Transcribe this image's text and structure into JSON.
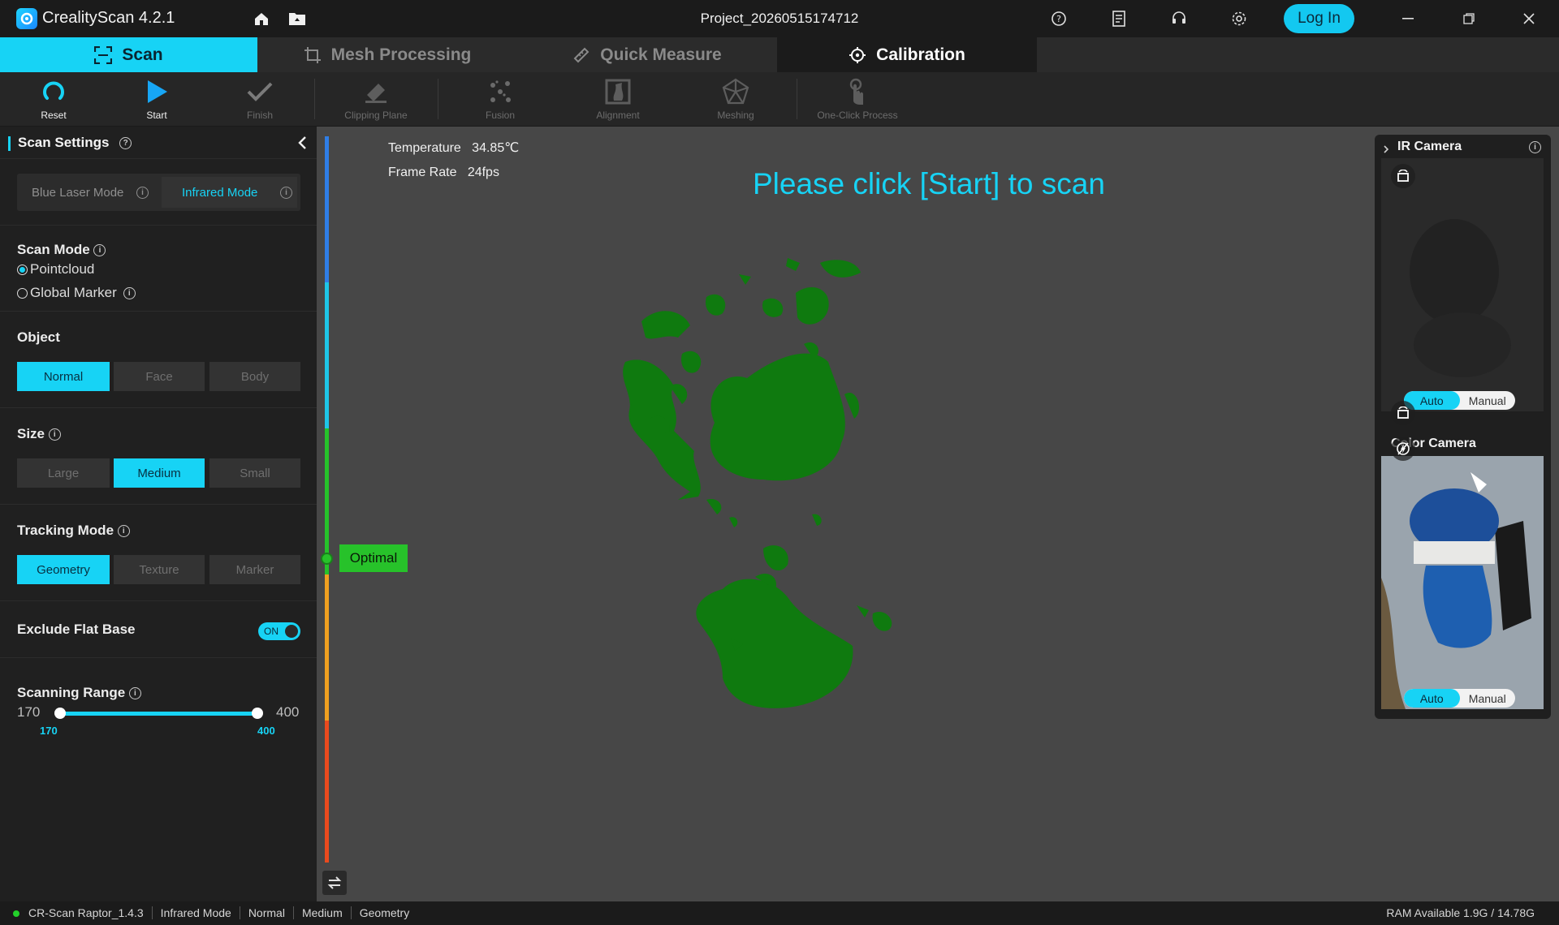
{
  "app": {
    "title": "CrealityScan 4.2.1",
    "project": "Project_20260515174712",
    "login_label": "Log In"
  },
  "tabs": [
    {
      "label": "Scan"
    },
    {
      "label": "Mesh Processing"
    },
    {
      "label": "Quick Measure"
    },
    {
      "label": "Calibration"
    }
  ],
  "toolbar": [
    {
      "label": "Reset",
      "icon": "reset-icon"
    },
    {
      "label": "Start",
      "icon": "play-icon"
    },
    {
      "label": "Finish",
      "icon": "check-icon"
    },
    {
      "label": "Clipping Plane",
      "icon": "eraser-icon"
    },
    {
      "label": "Fusion",
      "icon": "fusion-icon"
    },
    {
      "label": "Alignment",
      "icon": "alignment-icon"
    },
    {
      "label": "Meshing",
      "icon": "meshing-icon"
    },
    {
      "label": "One-Click Process",
      "icon": "hand-icon"
    }
  ],
  "scan_settings": {
    "title": "Scan Settings",
    "modes": [
      "Blue Laser Mode",
      "Infrared Mode"
    ],
    "scan_mode": {
      "title": "Scan Mode",
      "options": [
        "Pointcloud",
        "Global Marker"
      ],
      "selected": "Pointcloud"
    },
    "object": {
      "title": "Object",
      "options": [
        "Normal",
        "Face",
        "Body"
      ],
      "selected": "Normal"
    },
    "size": {
      "title": "Size",
      "options": [
        "Large",
        "Medium",
        "Small"
      ],
      "selected": "Medium"
    },
    "tracking": {
      "title": "Tracking Mode",
      "options": [
        "Geometry",
        "Texture",
        "Marker"
      ],
      "selected": "Geometry"
    },
    "exclude_flat_base": {
      "title": "Exclude Flat Base",
      "state": "ON"
    },
    "scanning_range": {
      "title": "Scanning Range",
      "min": "170",
      "max": "400",
      "low": "170",
      "high": "400"
    }
  },
  "viewport": {
    "temperature_label": "Temperature",
    "temperature_value": "34.85℃",
    "frame_rate_label": "Frame Rate",
    "frame_rate_value": "24fps",
    "prompt": "Please click [Start] to scan",
    "distance_indicator": "Optimal"
  },
  "cameras": {
    "ir_title": "IR Camera",
    "color_title": "Color Camera",
    "auto": "Auto",
    "manual": "Manual"
  },
  "statusbar": {
    "items": [
      "CR-Scan Raptor_1.4.3",
      "Infrared Mode",
      "Normal",
      "Medium",
      "Geometry"
    ],
    "ram": "RAM Available 1.9G / 14.78G"
  },
  "colors": {
    "accent": "#17d3f5",
    "pointcloud": "#0f7a0f",
    "optimal": "#27c22a"
  }
}
